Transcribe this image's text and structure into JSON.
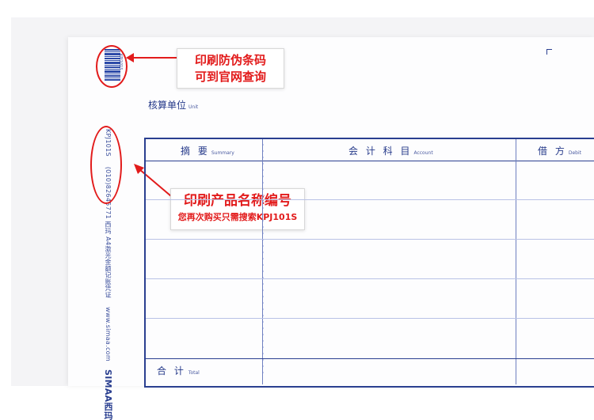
{
  "callouts": {
    "barcode_note": {
      "line1": "印刷防伪条码",
      "line2": "可到官网查询"
    },
    "product_note": {
      "line1": "印刷产品名称编号",
      "line2": "您再次购买只需搜索KPJ101S"
    }
  },
  "form": {
    "unit_label": "核算单位",
    "unit_label_en": "Unit",
    "barcode_text": "KPJ101S",
    "side_product": "KPJ101S",
    "side_text": "(010)82645771  西玛 A4激光金额记账凭证",
    "side_site": "www.simaa.com",
    "side_brand": "SIMAA西玛",
    "headers": {
      "summary": "摘 要",
      "summary_en": "Summary",
      "account": "会 计 科 目",
      "account_en": "Account",
      "debit": "借 方",
      "debit_en": "Debit"
    },
    "total": "合 计",
    "total_en": "Total"
  },
  "colors": {
    "accent_red": "#e21b1b",
    "form_blue": "#2a3f90"
  }
}
